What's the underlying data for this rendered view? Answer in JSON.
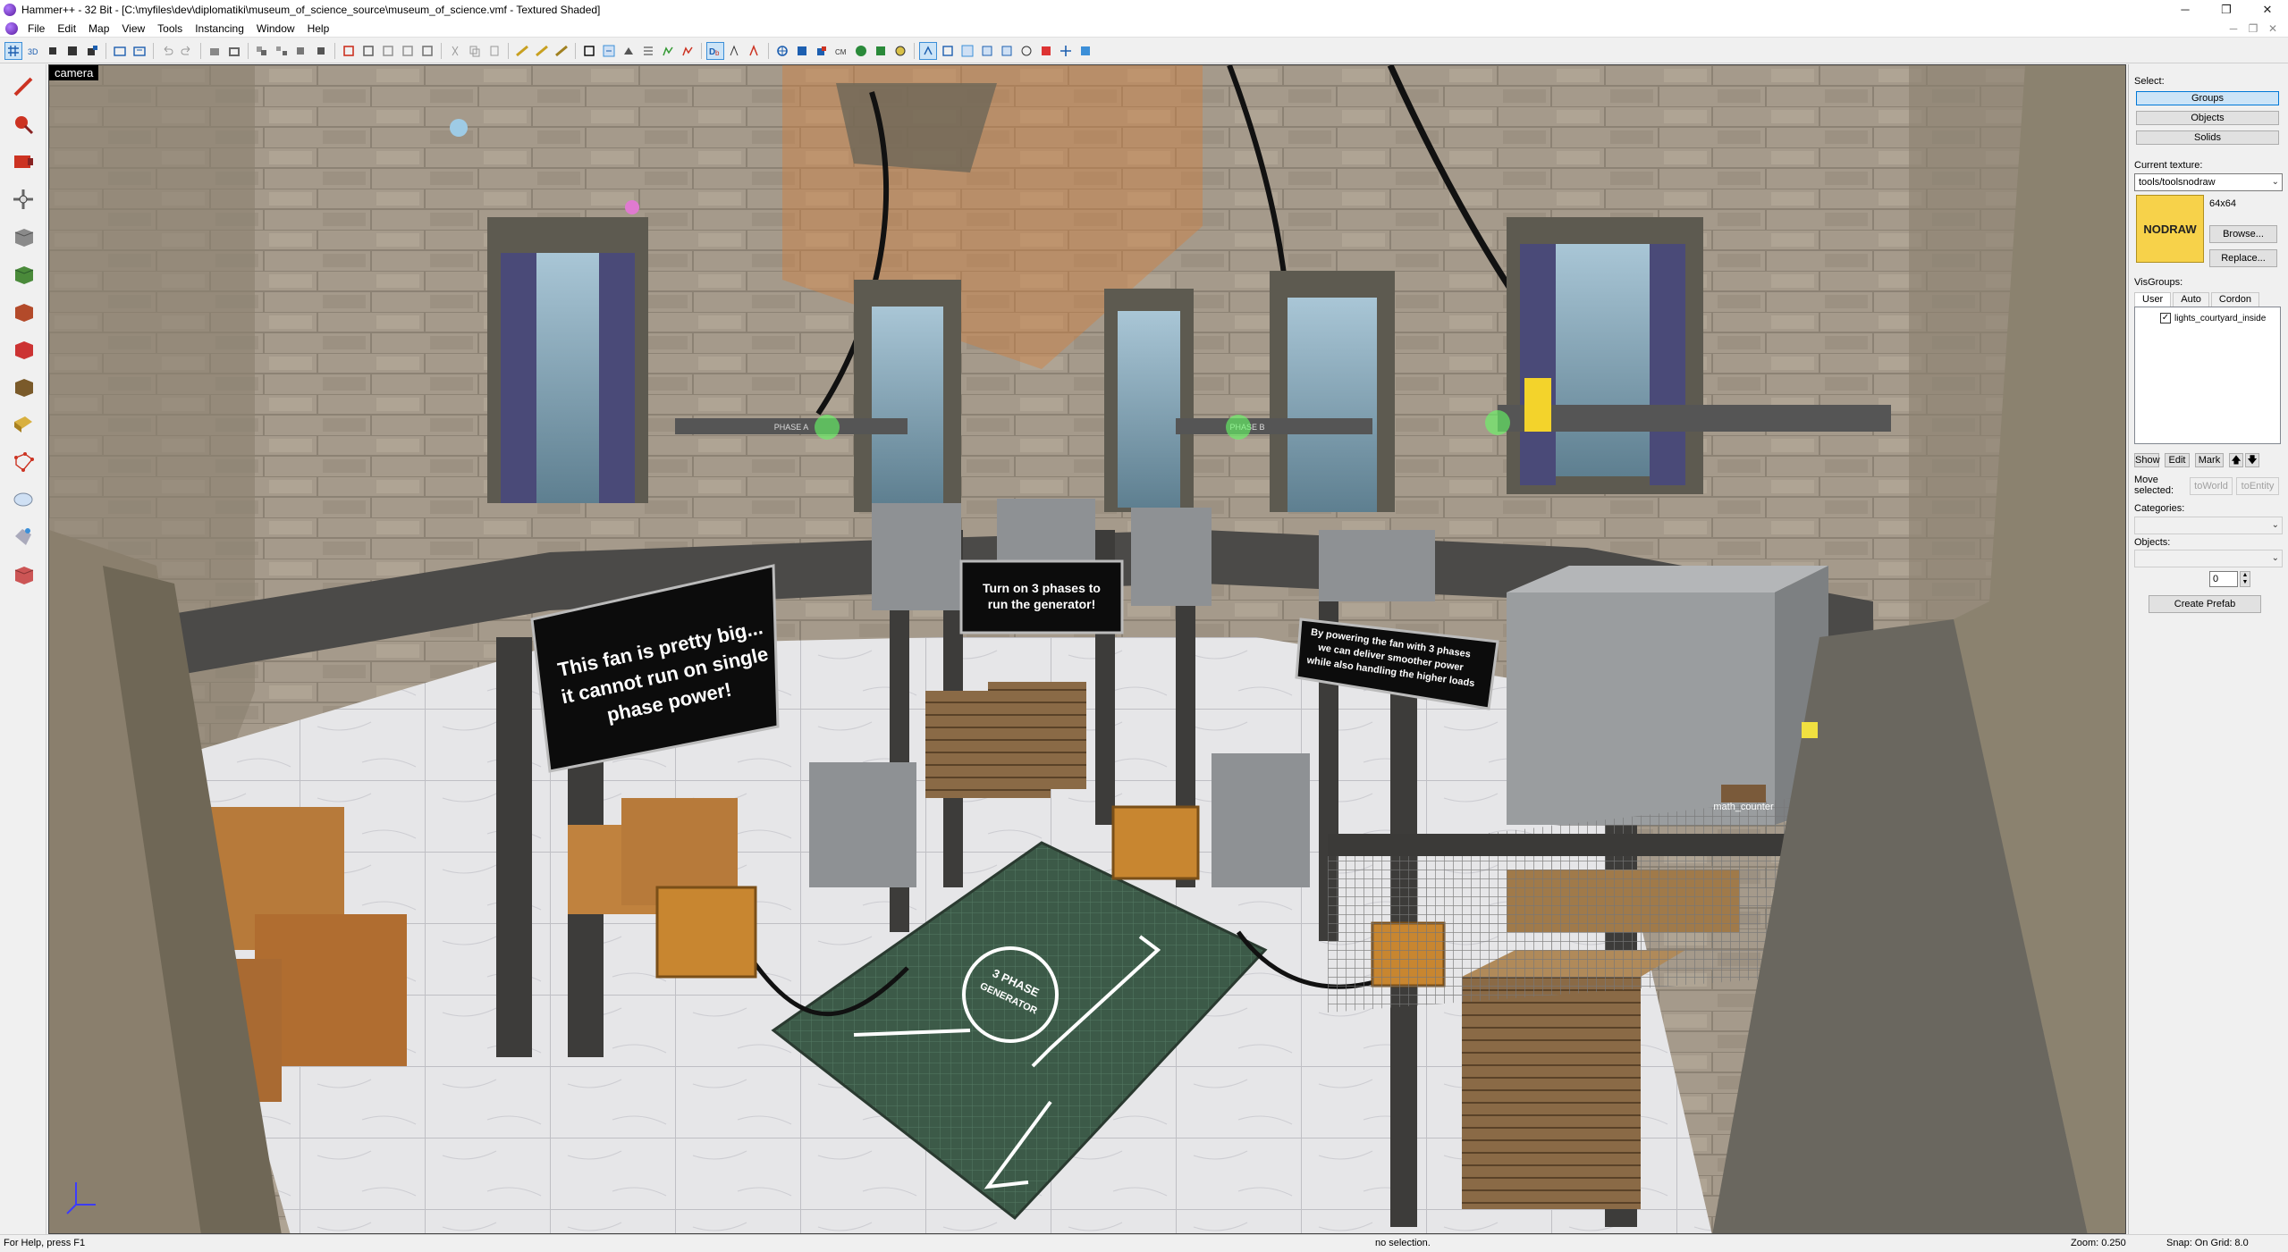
{
  "window": {
    "title": "Hammer++ - 32 Bit - [C:\\myfiles\\dev\\diplomatiki\\museum_of_science_source\\museum_of_science.vmf - Textured Shaded]",
    "controls": {
      "minimize": "─",
      "restore": "❐",
      "close": "✕"
    }
  },
  "menu": {
    "items": [
      "File",
      "Edit",
      "Map",
      "View",
      "Tools",
      "Instancing",
      "Window",
      "Help"
    ],
    "mdi_controls": {
      "minimize": "─",
      "restore": "❐",
      "close": "✕"
    }
  },
  "toolbar": {
    "buttons": [
      "grid-icon",
      "3d-grid-icon",
      "cube-small-icon",
      "cube-icon",
      "snap-icon",
      "sep",
      "undo-icon",
      "redo-icon",
      "sep",
      "carve-icon",
      "hollow-icon",
      "sep",
      "group-icon",
      "ungroup-icon",
      "tie-entity-icon",
      "sep",
      "cut-icon",
      "copy-icon",
      "paste-icon",
      "sep",
      "texture-lock-icon",
      "texture-lock-scale-icon",
      "sep",
      "hide-icon",
      "show-icon",
      "flip-icon",
      "compile-icon",
      "sep",
      "entity-report-icon",
      "check-problems-icon",
      "run-map-icon",
      "sep",
      "toggle-models-icon",
      "toggle-sprites-icon",
      "toggle-lights-icon",
      "toggle-cubemaps-icon",
      "toggle-paths-icon",
      "toggle-decals-icon",
      "sep",
      "autovisgroup-icon",
      "selection-icon",
      "sep",
      "texture-browser-icon",
      "quick-hide-icon",
      "sep"
    ]
  },
  "viewport": {
    "label": "camera",
    "signs": {
      "left": [
        "This fan is pretty big...",
        "it cannot run on single",
        "phase power!"
      ],
      "center": [
        "Turn on 3 phases to",
        "run the generator!"
      ],
      "right": [
        "By powering the fan with 3 phases",
        "we can deliver smoother power",
        "while also handling the higher loads"
      ]
    },
    "phase_labels": [
      "PHASE A",
      "PHASE B"
    ],
    "generator_label": [
      "3 PHASE",
      "GENERATOR"
    ],
    "entity_label": "math_counter"
  },
  "right_panel": {
    "select_label": "Select:",
    "select_buttons": [
      "Groups",
      "Objects",
      "Solids"
    ],
    "selected_mode": "Groups",
    "current_texture_label": "Current texture:",
    "current_texture": "tools/toolsnodraw",
    "texture_preview_text": "NODRAW",
    "texture_size": "64x64",
    "browse_label": "Browse...",
    "replace_label": "Replace...",
    "visgroups_label": "VisGroups:",
    "visgroup_tabs": [
      "User",
      "Auto",
      "Cordon"
    ],
    "active_visgroup_tab": "User",
    "visgroup_items": [
      {
        "name": "lights_courtyard_inside",
        "checked": true
      }
    ],
    "vg_buttons": {
      "show": "Show",
      "edit": "Edit",
      "mark": "Mark",
      "up": "🡅",
      "down": "🡇"
    },
    "move_selected_label": "Move selected:",
    "to_world_label": "toWorld",
    "to_entity_label": "toEntity",
    "categories_label": "Categories:",
    "objects_label": "Objects:",
    "spin_value": "0",
    "create_prefab_label": "Create Prefab",
    "swatch_color": "#f7d24a"
  },
  "status": {
    "help": "For Help, press F1",
    "selection": "no selection.",
    "zoom": "Zoom: 0.250",
    "snap": "Snap: On Grid: 8.0"
  }
}
